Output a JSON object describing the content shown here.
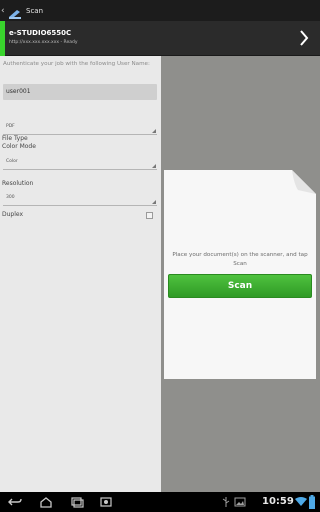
{
  "app": {
    "title": "Scan",
    "icons": {
      "back": "back-chevron-icon",
      "app": "scanner-app-icon"
    }
  },
  "device": {
    "name": "e-STUDIO6550C",
    "status": "http://xxx.xxx.xxx.xxx - Ready",
    "accent_color": "#39d42d"
  },
  "form": {
    "auth_prompt": "Authenticate your job with the following User Name:",
    "username": "user001",
    "file_type_label": "File Type",
    "file_type_value": "PDF",
    "color_mode_label": "Color Mode",
    "color_mode_value": "Color",
    "resolution_label": "Resolution",
    "resolution_value": "300",
    "duplex_label": "Duplex",
    "duplex_checked": false
  },
  "preview": {
    "instruction": "Place your document(s) on the scanner, and tap Scan",
    "scan_button": "Scan",
    "button_color": "#3bb02f"
  },
  "system": {
    "clock": "10:59",
    "nav_icons": [
      "back-icon",
      "home-icon",
      "recent-apps-icon",
      "screenshot-icon"
    ],
    "status_icons": [
      "usb-icon",
      "image-icon",
      "wifi-icon",
      "battery-icon"
    ]
  }
}
